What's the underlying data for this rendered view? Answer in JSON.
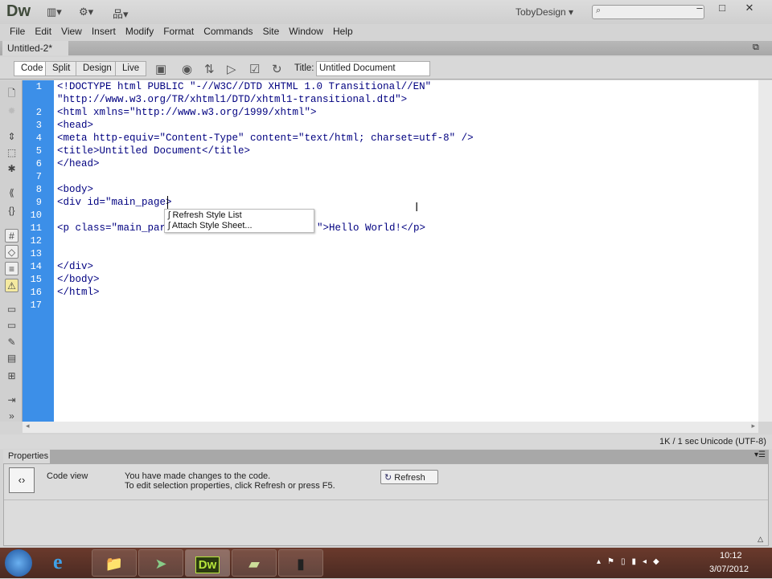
{
  "app": {
    "logo": "Dw",
    "workspace": "TobyDesign",
    "workspace_arrow": "▾",
    "search_placeholder": "⌕"
  },
  "window_controls": {
    "minimize": "‒",
    "maximize": "□",
    "close": "✕"
  },
  "menu": [
    "File",
    "Edit",
    "View",
    "Insert",
    "Modify",
    "Format",
    "Commands",
    "Site",
    "Window",
    "Help"
  ],
  "document_tab": {
    "label": "Untitled-2*",
    "close": "×"
  },
  "view_buttons": [
    "Code",
    "Split",
    "Design",
    "Live"
  ],
  "title_label": "Title:",
  "title_value": "Untitled Document",
  "code_lines": [
    {
      "num": "1",
      "text": "<!DOCTYPE html PUBLIC \"-//W3C//DTD XHTML 1.0 Transitional//EN\""
    },
    {
      "num": "",
      "text": "\"http://www.w3.org/TR/xhtml1/DTD/xhtml1-transitional.dtd\">"
    },
    {
      "num": "2",
      "text": "<html xmlns=\"http://www.w3.org/1999/xhtml\">"
    },
    {
      "num": "3",
      "text": "<head>"
    },
    {
      "num": "4",
      "text": "<meta http-equiv=\"Content-Type\" content=\"text/html; charset=utf-8\" />"
    },
    {
      "num": "5",
      "text": "<title>Untitled Document</title>"
    },
    {
      "num": "6",
      "text": "</head>"
    },
    {
      "num": "7",
      "text": ""
    },
    {
      "num": "8",
      "text": "<body>"
    },
    {
      "num": "9",
      "text": "<div id=\"main_page>"
    },
    {
      "num": "10",
      "text": ""
    },
    {
      "num": "11",
      "text": "<p class=\"main_par",
      "text_after": "\">Hello World!</p>"
    },
    {
      "num": "12",
      "text": ""
    },
    {
      "num": "13",
      "text": ""
    },
    {
      "num": "14",
      "text": "</div>"
    },
    {
      "num": "15",
      "text": "</body>"
    },
    {
      "num": "16",
      "text": "</html>"
    },
    {
      "num": "17",
      "text": ""
    }
  ],
  "autocomplete": [
    "Refresh Style List",
    "Attach Style Sheet..."
  ],
  "status": {
    "size": "1K / 1 sec",
    "encoding": "Unicode (UTF-8)"
  },
  "properties": {
    "tab": "Properties",
    "mode": "Code view",
    "message1": "You have made changes to the code.",
    "message2": "To edit selection properties, click Refresh or press F5.",
    "refresh_label": "Refresh"
  },
  "taskbar": {
    "clock_time": "10:12",
    "clock_date": "3/07/2012",
    "apps": [
      "start",
      "internet-explorer",
      "file-explorer",
      "send",
      "dreamweaver",
      "notes",
      "camera"
    ],
    "dw_label": "Dw"
  },
  "colors": {
    "gutter": "#3c8fe8",
    "code": "#000080"
  }
}
